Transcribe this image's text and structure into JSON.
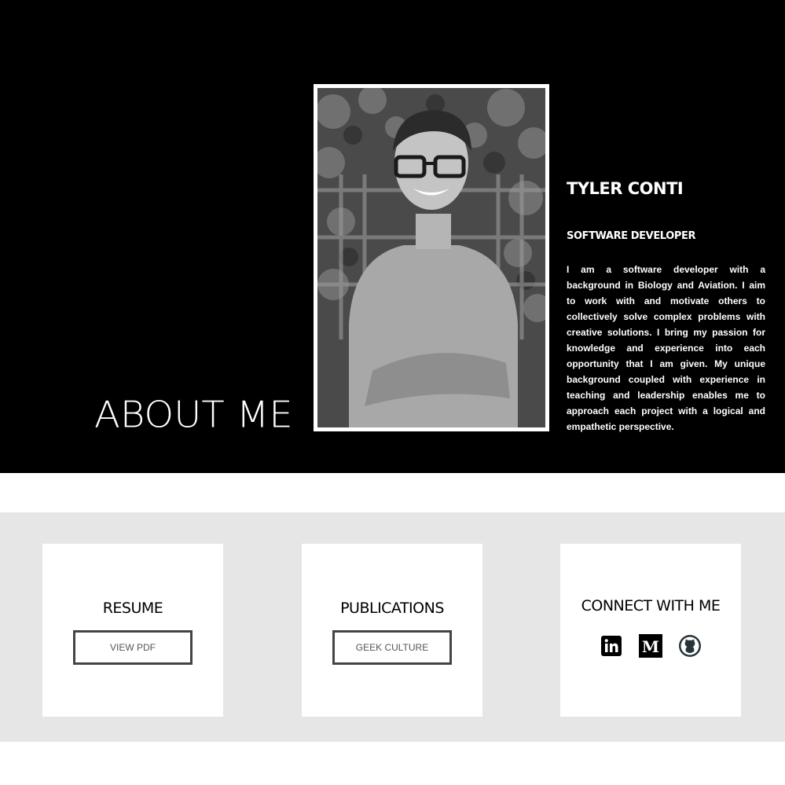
{
  "about": {
    "heading": "ABOUT ME",
    "name": "TYLER CONTI",
    "role": "SOFTWARE DEVELOPER",
    "bio": "I am a software developer with a background in Biology and Aviation. I aim to work with and motivate others to collectively solve complex problems with creative solutions. I bring my passion for knowledge and experience into each opportunity that I am given. My unique background coupled with experience in teaching and leadership enables me to approach each project with a logical and empathetic perspective."
  },
  "cards": {
    "resume": {
      "title": "RESUME",
      "button": "VIEW PDF"
    },
    "publications": {
      "title": "PUBLICATIONS",
      "button": "GEEK CULTURE"
    },
    "connect": {
      "title": "CONNECT WITH ME",
      "icons": [
        "linkedin-icon",
        "medium-icon",
        "github-icon"
      ]
    }
  },
  "colors": {
    "hero_bg": "#000000",
    "band_bg": "#e6e6e6",
    "card_bg": "#ffffff",
    "button_border": "#444444"
  }
}
